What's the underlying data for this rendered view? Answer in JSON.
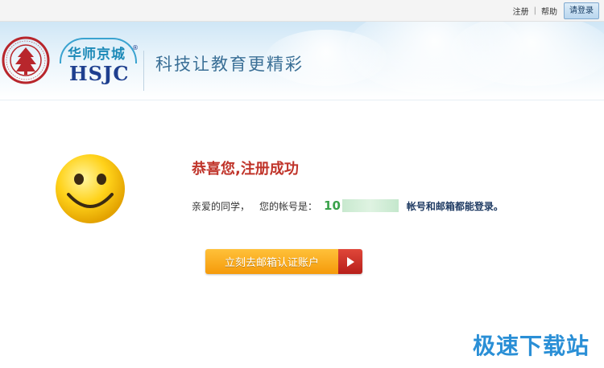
{
  "topbar": {
    "register_label": "注册",
    "separator": "|",
    "help_label": "帮助",
    "login_label": "请登录"
  },
  "header": {
    "brand_cn": "华师京城",
    "brand_en": "HSJC",
    "brand_reg": "®",
    "slogan": "科技让教育更精彩",
    "seal_icon": "university-seal-icon",
    "seal_color": "#b8262c"
  },
  "main": {
    "smiley_icon": "smiley-icon",
    "title": "恭喜您,注册成功",
    "greeting": "亲爱的同学，",
    "account_prefix": "您的帐号是：",
    "account_visible": "10",
    "login_note": "帐号和邮箱都能登录。",
    "verify_button": "立刻去邮箱认证账户",
    "title_color": "#c0342a",
    "button_color": "#f5a01a"
  },
  "watermark": {
    "text": "极速下载站"
  }
}
